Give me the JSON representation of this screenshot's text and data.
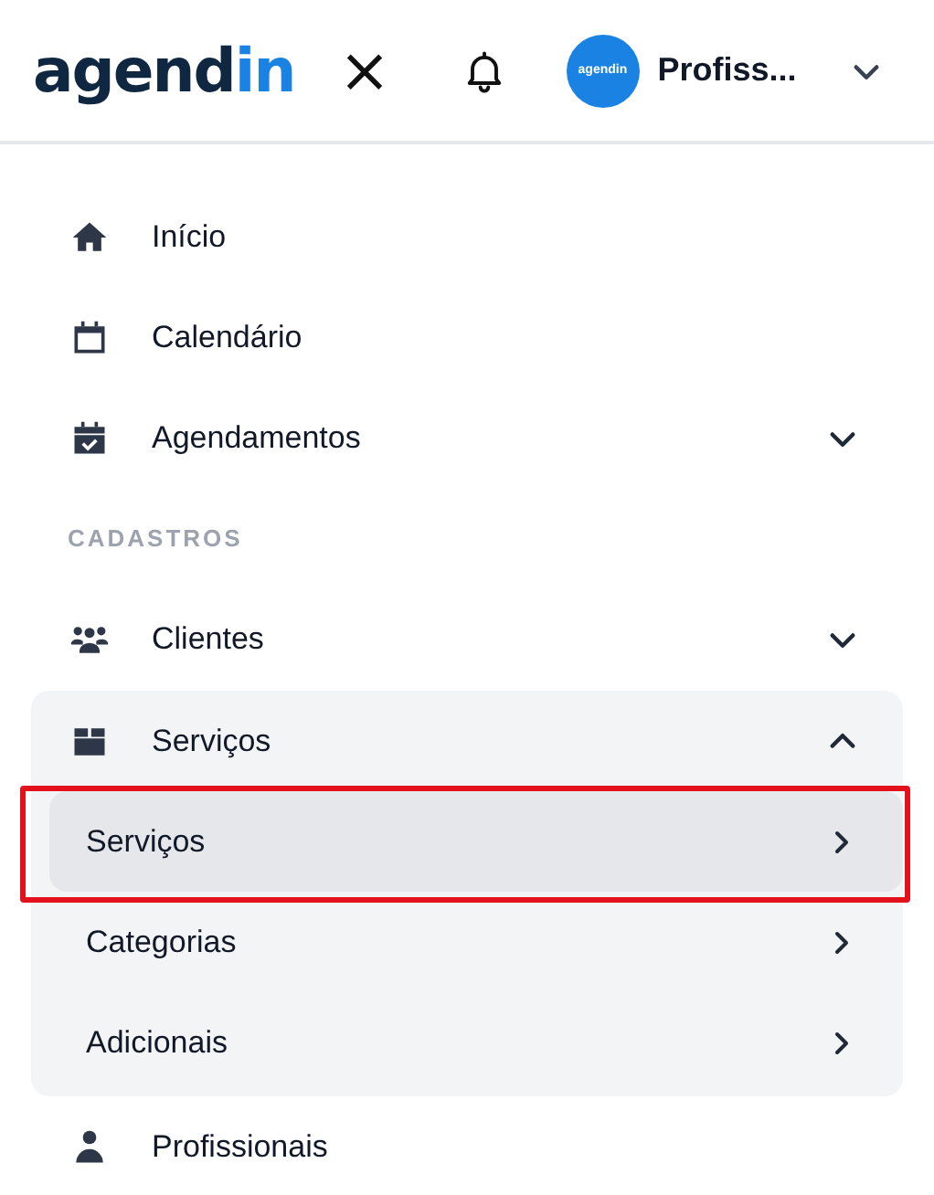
{
  "header": {
    "logo": {
      "text": "agend",
      "accent": "in"
    },
    "close": "×",
    "avatar": "agendin",
    "user": "Profiss..."
  },
  "menu": [
    {
      "kind": "item",
      "label": "Início"
    },
    {
      "kind": "item",
      "label": "Calendário"
    },
    {
      "kind": "item",
      "label": "Agendamentos",
      "expanded": false
    },
    {
      "kind": "section",
      "label": "CADASTROS"
    },
    {
      "kind": "item",
      "label": "Clientes",
      "expanded": false
    },
    {
      "kind": "item",
      "label": "Serviços",
      "expanded": true,
      "children": [
        {
          "label": "Serviços",
          "selected": true
        },
        {
          "label": "Categorias",
          "selected": false
        },
        {
          "label": "Adicionais",
          "selected": false
        }
      ]
    },
    {
      "kind": "item",
      "label": "Profissionais"
    }
  ]
}
